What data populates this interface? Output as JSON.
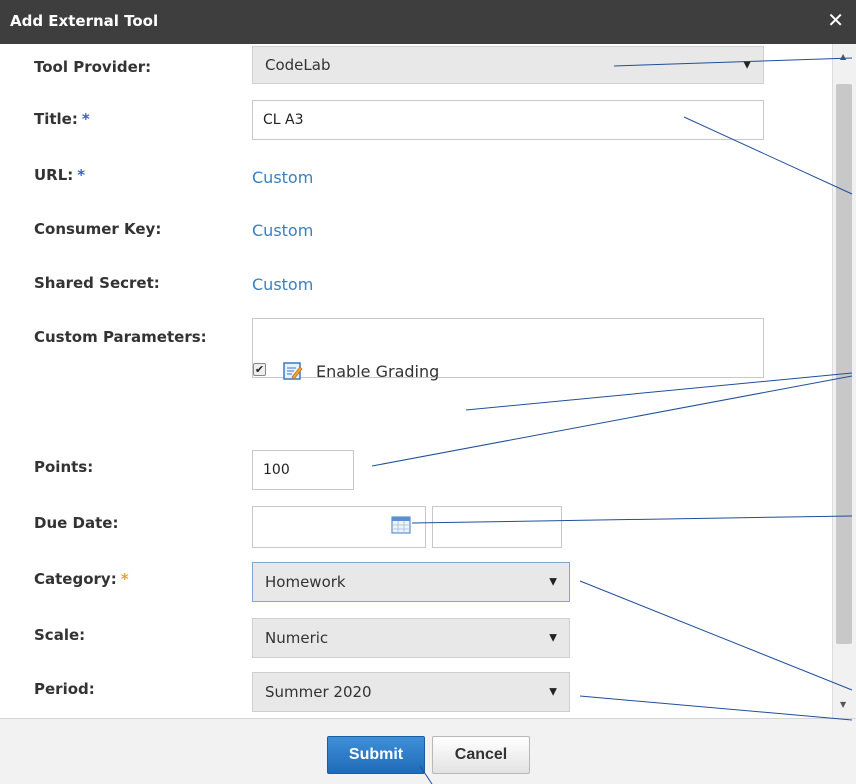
{
  "dialog": {
    "title": "Add External Tool",
    "close_icon": "close-icon",
    "close_glyph": "✕"
  },
  "form": {
    "tool_provider": {
      "label": "Tool Provider:",
      "value": "CodeLab"
    },
    "title": {
      "label": "Title:",
      "required_mark": "*",
      "value": "CL A3"
    },
    "url": {
      "label": "URL:",
      "required_mark": "*",
      "value": "Custom"
    },
    "consumer_key": {
      "label": "Consumer Key:",
      "value": "Custom"
    },
    "shared_secret": {
      "label": "Shared Secret:",
      "value": "Custom"
    },
    "custom_parameters": {
      "label": "Custom Parameters:",
      "value": ""
    },
    "enable_grading": {
      "label": "Enable Grading",
      "checked": true
    },
    "points": {
      "label": "Points:",
      "value": "100"
    },
    "due_date": {
      "label": "Due Date:",
      "date_value": "",
      "time_value": ""
    },
    "category": {
      "label": "Category:",
      "required_mark": "*",
      "value": "Homework"
    },
    "scale": {
      "label": "Scale:",
      "value": "Numeric"
    },
    "period": {
      "label": "Period:",
      "value": "Summer 2020"
    }
  },
  "footer": {
    "submit_label": "Submit",
    "cancel_label": "Cancel"
  },
  "colors": {
    "titlebar": "#3e3e3e",
    "link": "#3a7fc0",
    "required_blue": "#3b5bd6",
    "required_orange": "#f0a030",
    "submit": "#2a7cc8",
    "annotation_line": "#1f4f9a"
  }
}
